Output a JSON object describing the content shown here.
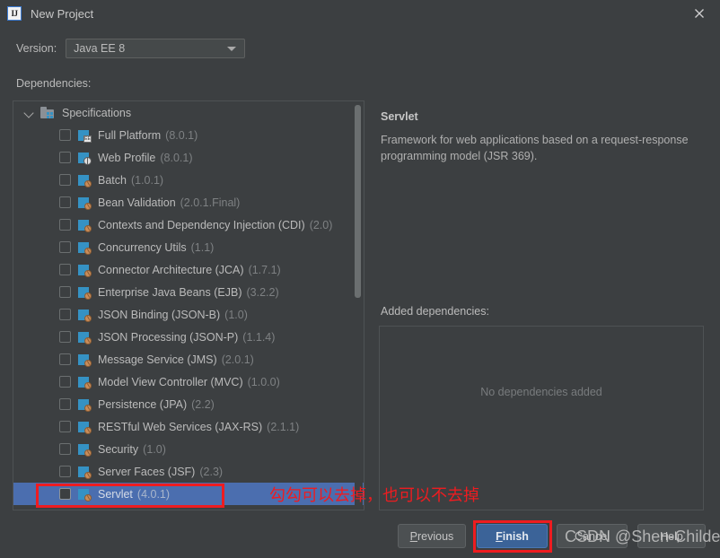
{
  "window": {
    "title": "New Project",
    "app_icon": "IJ",
    "close_icon": "close-icon"
  },
  "form": {
    "version_label": "Version:",
    "version_value": "Java EE 8",
    "dependencies_label": "Dependencies:"
  },
  "tree": {
    "root": {
      "label": "Specifications",
      "expanded": true
    },
    "items": [
      {
        "name": "Full Platform",
        "version": "(8.0.1)",
        "checked": false,
        "selected": false,
        "icon": "platform"
      },
      {
        "name": "Web Profile",
        "version": "(8.0.1)",
        "checked": false,
        "selected": false,
        "icon": "web"
      },
      {
        "name": "Batch",
        "version": "(1.0.1)",
        "checked": false,
        "selected": false,
        "icon": "bean"
      },
      {
        "name": "Bean Validation",
        "version": "(2.0.1.Final)",
        "checked": false,
        "selected": false,
        "icon": "bean"
      },
      {
        "name": "Contexts and Dependency Injection (CDI)",
        "version": "(2.0)",
        "checked": false,
        "selected": false,
        "icon": "bean"
      },
      {
        "name": "Concurrency Utils",
        "version": "(1.1)",
        "checked": false,
        "selected": false,
        "icon": "bean"
      },
      {
        "name": "Connector Architecture (JCA)",
        "version": "(1.7.1)",
        "checked": false,
        "selected": false,
        "icon": "bean"
      },
      {
        "name": "Enterprise Java Beans (EJB)",
        "version": "(3.2.2)",
        "checked": false,
        "selected": false,
        "icon": "bean"
      },
      {
        "name": "JSON Binding (JSON-B)",
        "version": "(1.0)",
        "checked": false,
        "selected": false,
        "icon": "bean"
      },
      {
        "name": "JSON Processing (JSON-P)",
        "version": "(1.1.4)",
        "checked": false,
        "selected": false,
        "icon": "bean"
      },
      {
        "name": "Message Service (JMS)",
        "version": "(2.0.1)",
        "checked": false,
        "selected": false,
        "icon": "bean"
      },
      {
        "name": "Model View Controller (MVC)",
        "version": "(1.0.0)",
        "checked": false,
        "selected": false,
        "icon": "bean"
      },
      {
        "name": "Persistence (JPA)",
        "version": "(2.2)",
        "checked": false,
        "selected": false,
        "icon": "bean"
      },
      {
        "name": "RESTful Web Services (JAX-RS)",
        "version": "(2.1.1)",
        "checked": false,
        "selected": false,
        "icon": "bean"
      },
      {
        "name": "Security",
        "version": "(1.0)",
        "checked": false,
        "selected": false,
        "icon": "bean"
      },
      {
        "name": "Server Faces (JSF)",
        "version": "(2.3)",
        "checked": false,
        "selected": false,
        "icon": "bean"
      },
      {
        "name": "Servlet",
        "version": "(4.0.1)",
        "checked": false,
        "selected": true,
        "icon": "bean"
      }
    ]
  },
  "detail": {
    "title": "Servlet",
    "description": "Framework for web applications based on a request-response programming model (JSR 369).",
    "added_label": "Added dependencies:",
    "added_empty": "No dependencies added"
  },
  "buttons": {
    "previous": "Previous",
    "previous_mnemonic": "P",
    "finish": "Finish",
    "finish_mnemonic": "F",
    "cancel": "Cancel",
    "help": "Help"
  },
  "annotations": {
    "note_text": "勾勾可以去掉，也可以不去掉",
    "color": "#ee1c20"
  },
  "watermark": "CSDN @Shen-Childe",
  "colors": {
    "background": "#3c3f41",
    "selection": "#4b6eaf",
    "accent": "#3b6398",
    "icon_blue": "#3592c4",
    "annotation_red": "#ee1c20"
  }
}
